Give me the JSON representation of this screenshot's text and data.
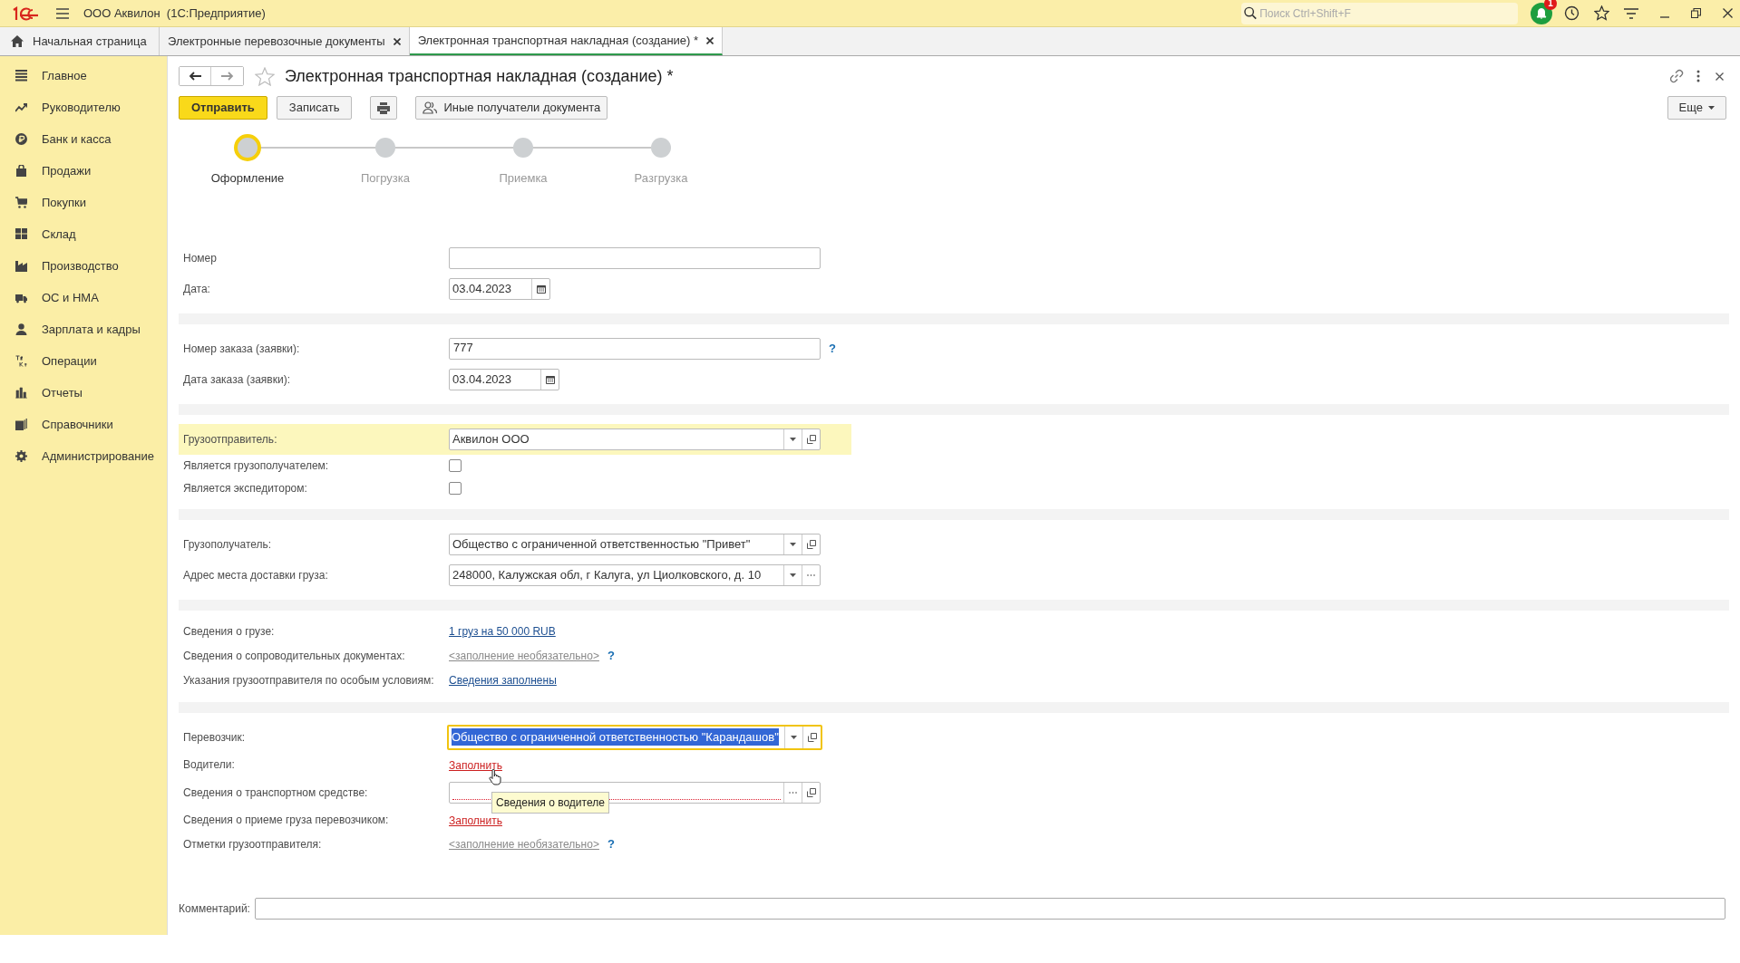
{
  "app": {
    "title": "ООО Аквилон  (1С:Предприятие)",
    "search_placeholder": "Поиск Ctrl+Shift+F",
    "notification_count": "1"
  },
  "tabs": [
    {
      "label": "Начальная страница",
      "kind": "home",
      "selected": false
    },
    {
      "label": "Электронные перевозочные документы",
      "kind": "page",
      "selected": false
    },
    {
      "label": "Электронная транспортная накладная (создание) *",
      "kind": "page",
      "selected": true
    }
  ],
  "sidebar": [
    {
      "label": "Главное"
    },
    {
      "label": "Руководителю"
    },
    {
      "label": "Банк и касса"
    },
    {
      "label": "Продажи"
    },
    {
      "label": "Покупки"
    },
    {
      "label": "Склад"
    },
    {
      "label": "Производство"
    },
    {
      "label": "ОС и НМА"
    },
    {
      "label": "Зарплата и кадры"
    },
    {
      "label": "Операции"
    },
    {
      "label": "Отчеты"
    },
    {
      "label": "Справочники"
    },
    {
      "label": "Администрирование"
    }
  ],
  "document": {
    "title": "Электронная транспортная накладная (создание) *",
    "buttons": [
      {
        "kind": "primary",
        "label": "Отправить"
      },
      {
        "kind": "default",
        "label": "Записать"
      },
      {
        "kind": "print"
      },
      {
        "kind": "recipients",
        "label": "Иные получатели документа"
      }
    ],
    "more_button": "Еще",
    "steps": [
      {
        "label": "Оформление",
        "selected": true
      },
      {
        "label": "Погрузка",
        "selected": false
      },
      {
        "label": "Приемка",
        "selected": false
      },
      {
        "label": "Разгрузка",
        "selected": false
      }
    ],
    "groups": [
      [
        {
          "label": "Номер",
          "kind": "text"
        },
        {
          "label": "Дата:",
          "kind": "date",
          "value": "03.04.2023"
        }
      ],
      [
        {
          "label": "Номер заказа (заявки):",
          "kind": "text",
          "value": "777",
          "help": "?"
        },
        {
          "label": "Дата заказа (заявки):",
          "kind": "date",
          "value": "03.04.2023"
        }
      ],
      [
        {
          "label": "Грузоотправитель:",
          "kind": "select",
          "value": "Аквилон ООО",
          "highlighted": true
        },
        {
          "label": "Является грузополучателем:",
          "kind": "checkbox",
          "checked": false
        },
        {
          "label": "Является экспедитором:",
          "kind": "checkbox",
          "checked": false
        }
      ],
      [
        {
          "label": "Грузополучатель:",
          "kind": "select",
          "value": "Общество с ограниченной ответственностью \"Привет\""
        },
        {
          "label": "Адрес места доставки груза:",
          "kind": "address",
          "value": "248000, Калужская обл, г Калуга, ул Циолковского, д. 10"
        }
      ],
      [
        {
          "label": "Сведения о грузе:",
          "kind": "link",
          "value": "1 груз на 50 000 RUB"
        },
        {
          "label": "Сведения о сопроводительных документах:",
          "kind": "optional-link",
          "value": "<заполнение необязательно>",
          "help": "?"
        },
        {
          "label": "Указания грузоотправителя по особым условиям:",
          "kind": "link",
          "value": "Сведения заполнены"
        }
      ],
      [
        {
          "label": "Перевозчик:",
          "kind": "select",
          "value": "Общество с ограниченной ответственностью \"Карандашов\"",
          "focused": true
        },
        {
          "label": "Водители:",
          "kind": "required-link",
          "value": "Заполнить"
        },
        {
          "label": "Сведения о транспортном средстве:",
          "kind": "picker"
        },
        {
          "label": "Сведения о приеме груза перевозчиком:",
          "kind": "required-link",
          "value": "Заполнить"
        },
        {
          "label": "Отметки грузоотправителя:",
          "kind": "optional-link",
          "value": "<заполнение необязательно>",
          "help": "?"
        }
      ]
    ],
    "comment_label": "Комментарий:"
  },
  "tooltip": "Сведения о водителе"
}
